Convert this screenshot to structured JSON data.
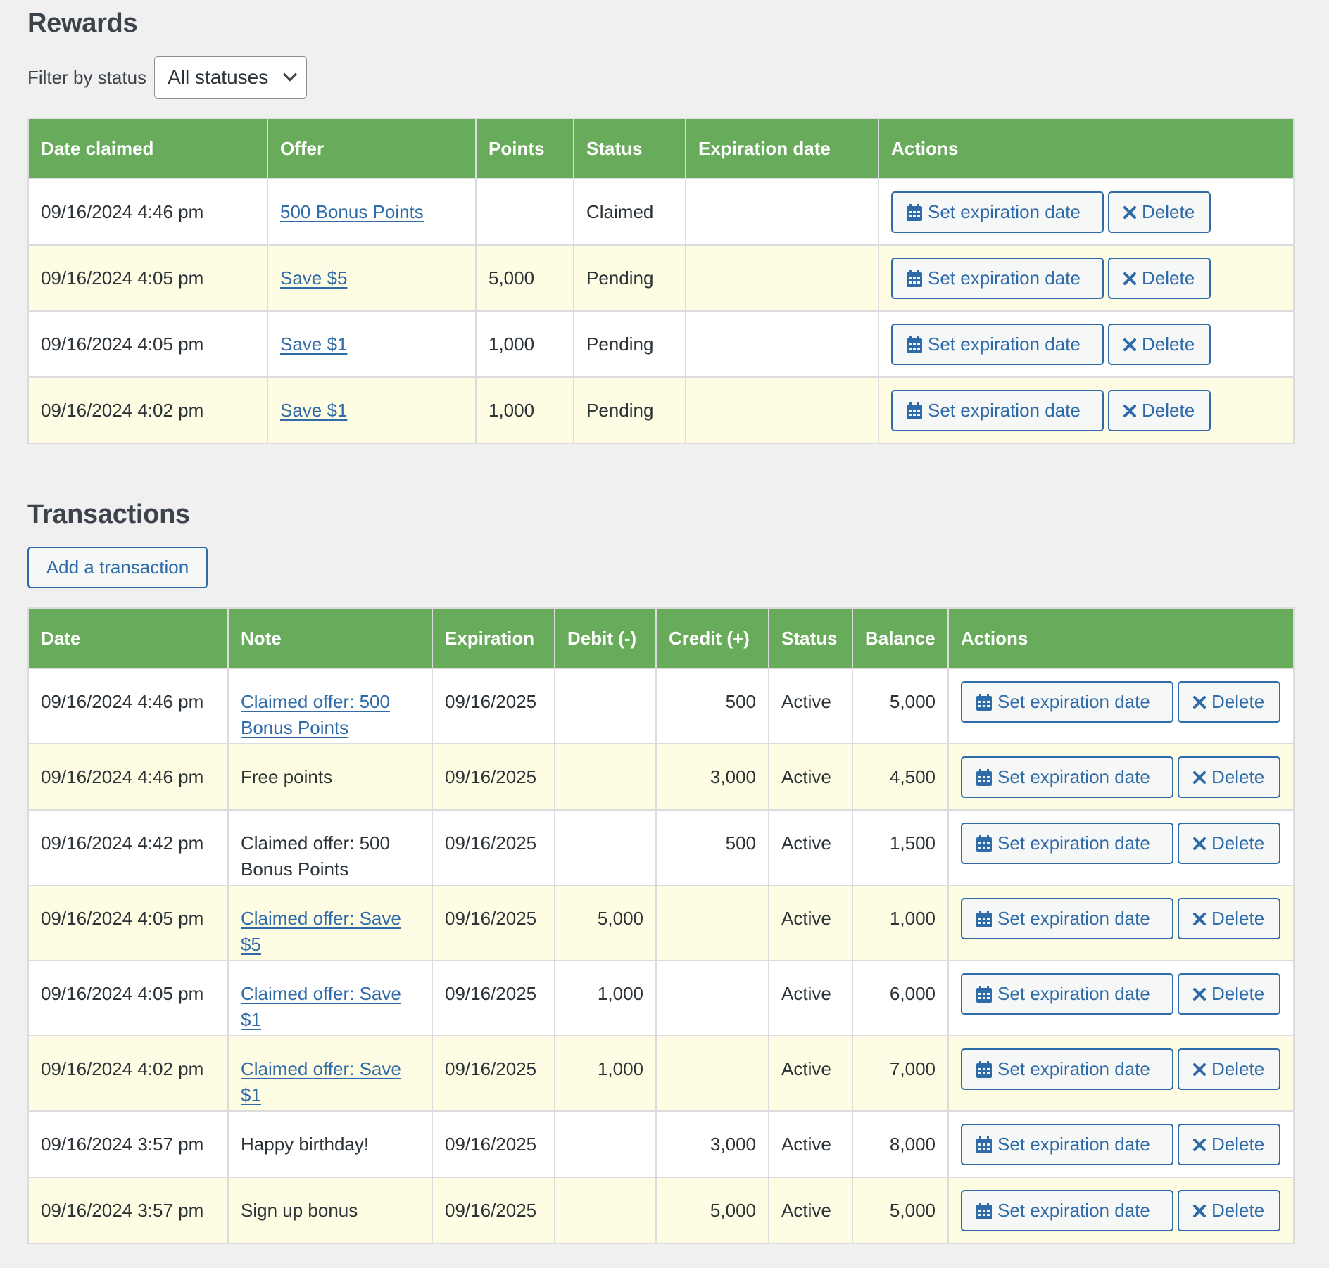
{
  "rewards": {
    "title": "Rewards",
    "filter": {
      "label": "Filter by status",
      "selected": "All statuses"
    },
    "columns": [
      "Date claimed",
      "Offer",
      "Points",
      "Status",
      "Expiration date",
      "Actions"
    ],
    "rows": [
      {
        "date": "09/16/2024 4:46 pm",
        "offer": "500 Bonus Points",
        "points": "",
        "status": "Claimed",
        "expiration": ""
      },
      {
        "date": "09/16/2024 4:05 pm",
        "offer": "Save $5",
        "points": "5,000",
        "status": "Pending",
        "expiration": ""
      },
      {
        "date": "09/16/2024 4:05 pm",
        "offer": "Save $1",
        "points": "1,000",
        "status": "Pending",
        "expiration": ""
      },
      {
        "date": "09/16/2024 4:02 pm",
        "offer": "Save $1",
        "points": "1,000",
        "status": "Pending",
        "expiration": ""
      }
    ]
  },
  "actions": {
    "set_expiration": "Set expiration date",
    "delete": "Delete",
    "set_expiration_icon": "calendar-icon",
    "delete_icon": "close-icon"
  },
  "transactions": {
    "title": "Transactions",
    "add_button": "Add a transaction",
    "columns": [
      "Date",
      "Note",
      "Expiration",
      "Debit (-)",
      "Credit (+)",
      "Status",
      "Balance",
      "Actions"
    ],
    "rows": [
      {
        "date": "09/16/2024 4:46 pm",
        "note": "Claimed offer: 500 Bonus Points",
        "note_is_link": true,
        "expiration": "09/16/2025",
        "debit": "",
        "credit": "500",
        "status": "Active",
        "balance": "5,000"
      },
      {
        "date": "09/16/2024 4:46 pm",
        "note": "Free points",
        "note_is_link": false,
        "expiration": "09/16/2025",
        "debit": "",
        "credit": "3,000",
        "status": "Active",
        "balance": "4,500"
      },
      {
        "date": "09/16/2024 4:42 pm",
        "note": "Claimed offer: 500 Bonus Points",
        "note_is_link": false,
        "expiration": "09/16/2025",
        "debit": "",
        "credit": "500",
        "status": "Active",
        "balance": "1,500"
      },
      {
        "date": "09/16/2024 4:05 pm",
        "note": "Claimed offer: Save $5",
        "note_is_link": true,
        "expiration": "09/16/2025",
        "debit": "5,000",
        "credit": "",
        "status": "Active",
        "balance": "1,000"
      },
      {
        "date": "09/16/2024 4:05 pm",
        "note": "Claimed offer: Save $1",
        "note_is_link": true,
        "expiration": "09/16/2025",
        "debit": "1,000",
        "credit": "",
        "status": "Active",
        "balance": "6,000"
      },
      {
        "date": "09/16/2024 4:02 pm",
        "note": "Claimed offer: Save $1",
        "note_is_link": true,
        "expiration": "09/16/2025",
        "debit": "1,000",
        "credit": "",
        "status": "Active",
        "balance": "7,000"
      },
      {
        "date": "09/16/2024 3:57 pm",
        "note": "Happy birthday!",
        "note_is_link": false,
        "expiration": "09/16/2025",
        "debit": "",
        "credit": "3,000",
        "status": "Active",
        "balance": "8,000"
      },
      {
        "date": "09/16/2024 3:57 pm",
        "note": "Sign up bonus",
        "note_is_link": false,
        "expiration": "09/16/2025",
        "debit": "",
        "credit": "5,000",
        "status": "Active",
        "balance": "5,000"
      }
    ]
  },
  "colors": {
    "header_green": "#67ab5b",
    "link_blue": "#2f6ba8",
    "alt_row": "#fefde3",
    "page_bg": "#f0f0f1"
  }
}
